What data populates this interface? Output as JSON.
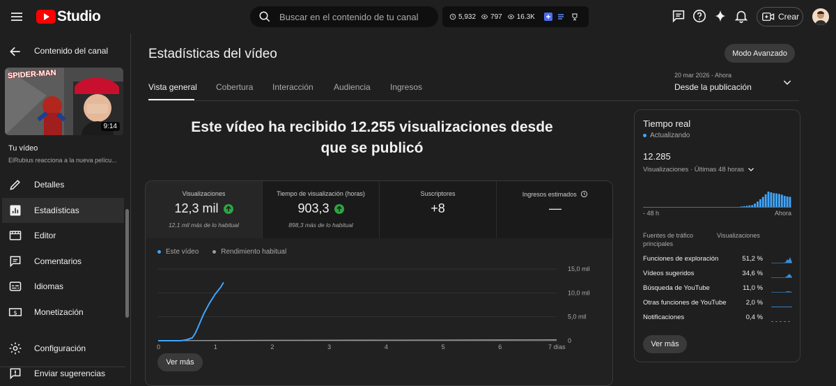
{
  "topbar": {
    "logo_text": "Studio",
    "search_placeholder": "Buscar en el contenido de tu canal",
    "stats": [
      "5,932",
      "797",
      "16.3K"
    ],
    "crear_label": "Crear"
  },
  "sidebar": {
    "back_title": "Contenido del canal",
    "thumbnail_duration": "9:14",
    "thumbnail_logo": "SPIDER-MAN",
    "video_heading": "Tu vídeo",
    "video_title": "ElRubius reacciona a la nueva pelícu...",
    "items": [
      {
        "label": "Detalles",
        "icon": "pencil-icon"
      },
      {
        "label": "Estadísticas",
        "icon": "analytics-icon"
      },
      {
        "label": "Editor",
        "icon": "editor-icon"
      },
      {
        "label": "Comentarios",
        "icon": "comments-icon"
      },
      {
        "label": "Idiomas",
        "icon": "subtitles-icon"
      },
      {
        "label": "Monetización",
        "icon": "dollar-icon"
      },
      {
        "label": "Configuración",
        "icon": "gear-icon"
      },
      {
        "label": "Enviar sugerencias",
        "icon": "feedback-icon"
      }
    ]
  },
  "main": {
    "title": "Estadísticas del vídeo",
    "advanced_mode": "Modo Avanzado",
    "tabs": [
      "Vista general",
      "Cobertura",
      "Interacción",
      "Audiencia",
      "Ingresos"
    ],
    "period_dates": "20 mar 2026 - Ahora",
    "period_label": "Desde la publicación",
    "headline": "Este vídeo ha recibido 12.255 visualizaciones desde que se publicó",
    "metrics": [
      {
        "label": "Visualizaciones",
        "value": "12,3 mil",
        "sub": "12,1 mil más de lo habitual"
      },
      {
        "label": "Tiempo de visualización (horas)",
        "value": "903,3",
        "sub": "898,3 más de lo habitual"
      },
      {
        "label": "Suscriptores",
        "value": "+8",
        "sub": ""
      },
      {
        "label": "Ingresos estimados",
        "value": "—",
        "sub": ""
      }
    ],
    "legend": [
      "Este vídeo",
      "Rendimiento habitual"
    ],
    "see_more": "Ver más"
  },
  "chart_data": {
    "type": "line",
    "x_tick_labels": [
      "0",
      "1",
      "2",
      "3",
      "4",
      "5",
      "6",
      "7 días"
    ],
    "y_tick_labels": [
      "0",
      "5,0 mil",
      "10,0 mil",
      "15,0 mil"
    ],
    "ylim": [
      0,
      15000
    ],
    "xlim": [
      0,
      7
    ],
    "grid": true,
    "series": [
      {
        "name": "Este vídeo",
        "color": "#3ea6ff",
        "x": [
          0,
          0.2,
          0.4,
          0.5,
          0.6,
          0.65,
          0.7,
          0.75,
          0.8,
          0.9,
          1.0,
          1.1,
          1.15
        ],
        "y": [
          0,
          0,
          0,
          200,
          600,
          1500,
          2800,
          4200,
          5600,
          7800,
          9700,
          11200,
          12200
        ]
      },
      {
        "name": "Rendimiento habitual",
        "color": "#9e9e9e",
        "x": [
          0,
          1,
          2,
          3,
          4,
          5,
          6,
          7
        ],
        "y": [
          0,
          60,
          90,
          110,
          130,
          150,
          170,
          190
        ]
      }
    ]
  },
  "realtime": {
    "title": "Tiempo real",
    "status": "Actualizando",
    "count": "12.285",
    "subtitle": "Visualizaciones · Últimas 48 horas",
    "axis_left": "- 48 h",
    "axis_right": "Ahora",
    "bars": [
      0,
      0,
      0,
      0,
      0,
      0,
      0,
      0,
      0,
      0,
      0,
      0,
      0,
      0,
      0,
      0,
      0,
      0,
      0,
      0,
      0,
      0,
      0,
      0,
      0,
      0,
      0,
      0,
      0,
      0,
      0,
      0,
      0,
      0,
      0,
      0,
      0.03,
      0.05,
      0.07,
      0.1,
      0.12,
      0.22,
      0.35,
      0.5,
      0.65,
      0.82,
      1.0,
      0.95,
      0.9,
      0.88,
      0.85,
      0.8,
      0.72,
      0.68,
      0.66
    ],
    "table_header_source": "Fuentes de tráfico principales",
    "table_header_views": "Visualizaciones",
    "sources": [
      {
        "name": "Funciones de exploración",
        "pct": "51,2 %"
      },
      {
        "name": "Vídeos sugeridos",
        "pct": "34,6 %"
      },
      {
        "name": "Búsqueda de YouTube",
        "pct": "11,0 %"
      },
      {
        "name": "Otras funciones de YouTube",
        "pct": "2,0 %"
      },
      {
        "name": "Notificaciones",
        "pct": "0,4 %"
      }
    ],
    "see_more": "Ver más"
  }
}
